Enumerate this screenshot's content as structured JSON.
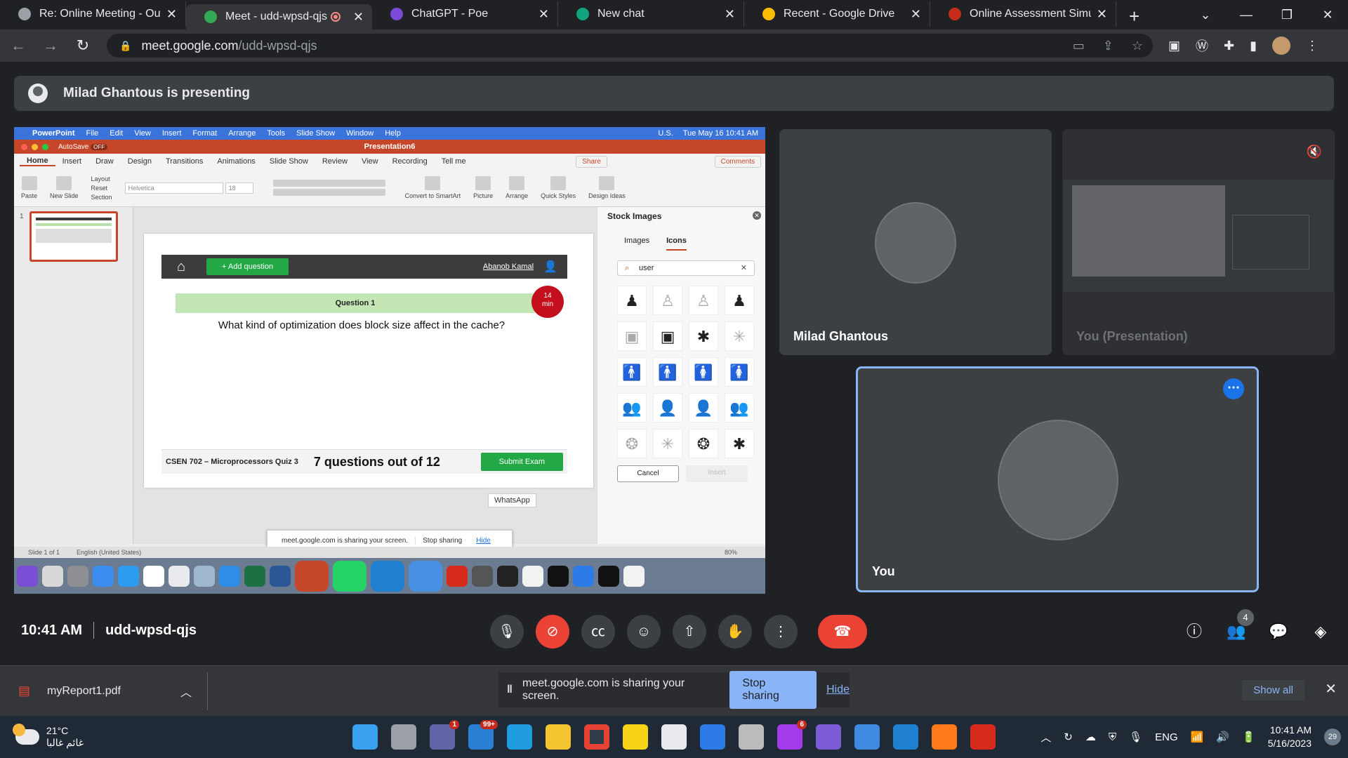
{
  "browser": {
    "tabs": [
      {
        "title": "Re: Online Meeting - Outlo",
        "color": "#9aa0a6"
      },
      {
        "title": "Meet - udd-wpsd-qjs",
        "color": "#34a853"
      },
      {
        "title": "ChatGPT - Poe",
        "color": "#7b4ad9"
      },
      {
        "title": "New chat",
        "color": "#10a37f"
      },
      {
        "title": "Recent - Google Drive",
        "color": "#fbbc04"
      },
      {
        "title": "Online Assessment Simulat",
        "color": "#c42b1c"
      }
    ],
    "url_host": "meet.google.com",
    "url_path": "/udd-wpsd-qjs"
  },
  "presenting": {
    "text": "Milad Ghantous is presenting"
  },
  "mac": {
    "app": "PowerPoint",
    "menus": [
      "File",
      "Edit",
      "View",
      "Insert",
      "Format",
      "Arrange",
      "Tools",
      "Slide Show",
      "Window",
      "Help"
    ],
    "lang": "U.S.",
    "datetime": "Tue May 16  10:41 AM"
  },
  "ppt": {
    "autosave": "AutoSave",
    "autosave_state": "OFF",
    "title": "Presentation6",
    "tabs": [
      "Home",
      "Insert",
      "Draw",
      "Design",
      "Transitions",
      "Animations",
      "Slide Show",
      "Review",
      "View",
      "Recording",
      "Tell me"
    ],
    "share": "Share",
    "comments": "Comments",
    "ribbon": {
      "paste": "Paste",
      "new_slide": "New Slide",
      "layout": "Layout",
      "reset": "Reset",
      "section": "Section",
      "font": "Helvetica",
      "size": "18",
      "convert": "Convert to SmartArt",
      "picture": "Picture",
      "arrange": "Arrange",
      "quick_styles": "Quick Styles",
      "design_ideas": "Design Ideas"
    },
    "slide_number": "1",
    "status": {
      "slide": "Slide 1 of 1",
      "lang": "English (United States)",
      "zoom": "80%"
    },
    "whatsapp_label": "WhatsApp"
  },
  "slide": {
    "add_question": "+ Add question",
    "user": "Abanob Kamal",
    "question_title": "Question 1",
    "timer_value": "14",
    "timer_unit": "min",
    "question": "What kind of optimization does block size affect in the cache?",
    "course": "CSEN 702 – Microprocessors Quiz 3",
    "progress": "7 questions out of 12",
    "submit": "Submit Exam"
  },
  "stock": {
    "title": "Stock Images",
    "tab_images": "Images",
    "tab_icons": "Icons",
    "search": "user",
    "cancel": "Cancel",
    "insert": "Insert"
  },
  "mini_share": {
    "text": "meet.google.com is sharing your screen.",
    "stop": "Stop sharing",
    "hide": "Hide"
  },
  "participants": {
    "milad": "Milad Ghantous",
    "presentation": "You (Presentation)",
    "you": "You",
    "count": "4"
  },
  "meeting": {
    "time": "10:41 AM",
    "code": "udd-wpsd-qjs"
  },
  "download": {
    "file": "myReport1.pdf",
    "show_all": "Show all"
  },
  "share_notice": {
    "text": "meet.google.com is sharing your screen.",
    "stop": "Stop sharing",
    "hide": "Hide"
  },
  "taskbar": {
    "temp": "21°C",
    "weather_text": "غائم غالبا",
    "teams_badge": "1",
    "mail_badge": "99+",
    "messenger_badge": "6",
    "lang": "ENG",
    "time": "10:41 AM",
    "date": "5/16/2023",
    "notifications": "29"
  }
}
